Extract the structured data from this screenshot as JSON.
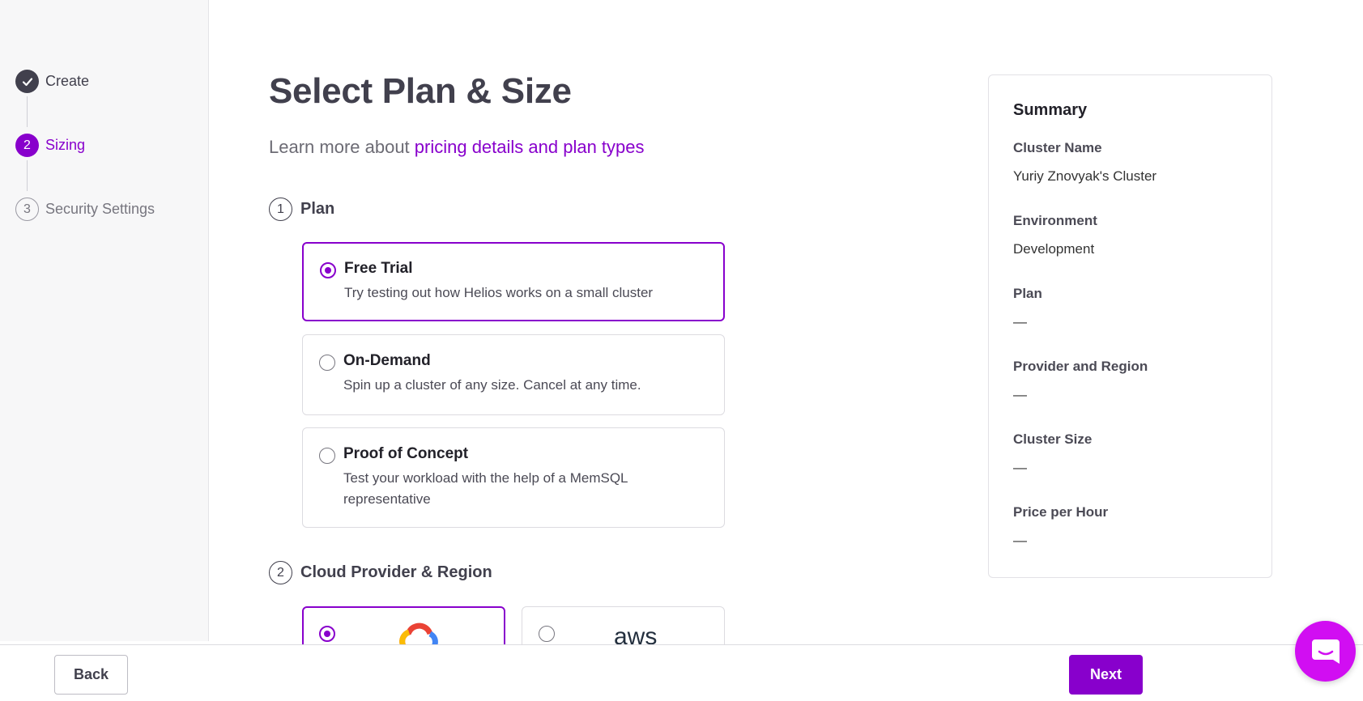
{
  "wizard": {
    "steps": [
      {
        "number": "",
        "label": "Create",
        "state": "done"
      },
      {
        "number": "2",
        "label": "Sizing",
        "state": "active"
      },
      {
        "number": "3",
        "label": "Security Settings",
        "state": "todo"
      }
    ]
  },
  "main": {
    "title": "Select Plan & Size",
    "subtitle_prefix": "Learn more about ",
    "subtitle_link": "pricing details and plan types",
    "sections": [
      {
        "number": "1",
        "title": "Plan"
      },
      {
        "number": "2",
        "title": "Cloud Provider & Region"
      }
    ],
    "plans": [
      {
        "name": "Free Trial",
        "description": "Try testing out how Helios works on a small cluster",
        "selected": true
      },
      {
        "name": "On-Demand",
        "description": "Spin up a cluster of any size. Cancel at any time.",
        "selected": false
      },
      {
        "name": "Proof of Concept",
        "description": "Test your workload with the help of a MemSQL representative",
        "selected": false
      }
    ],
    "providers": [
      {
        "name": "google-cloud",
        "icon": "google-cloud-logo-icon",
        "selected": true
      },
      {
        "name": "aws",
        "label": "aws",
        "icon": "aws-logo-icon",
        "selected": false
      }
    ]
  },
  "summary": {
    "title": "Summary",
    "items": [
      {
        "label": "Cluster Name",
        "value": "Yuriy Znovyak's Cluster"
      },
      {
        "label": "Environment",
        "value": "Development"
      },
      {
        "label": "Plan",
        "value": "—"
      },
      {
        "label": "Provider and Region",
        "value": "—"
      },
      {
        "label": "Cluster Size",
        "value": "—"
      },
      {
        "label": "Price per Hour",
        "value": "—"
      }
    ]
  },
  "footer": {
    "back_label": "Back",
    "next_label": "Next"
  },
  "colors": {
    "accent": "#8800cc",
    "chat": "#d10ef2",
    "dark": "#41404d"
  }
}
